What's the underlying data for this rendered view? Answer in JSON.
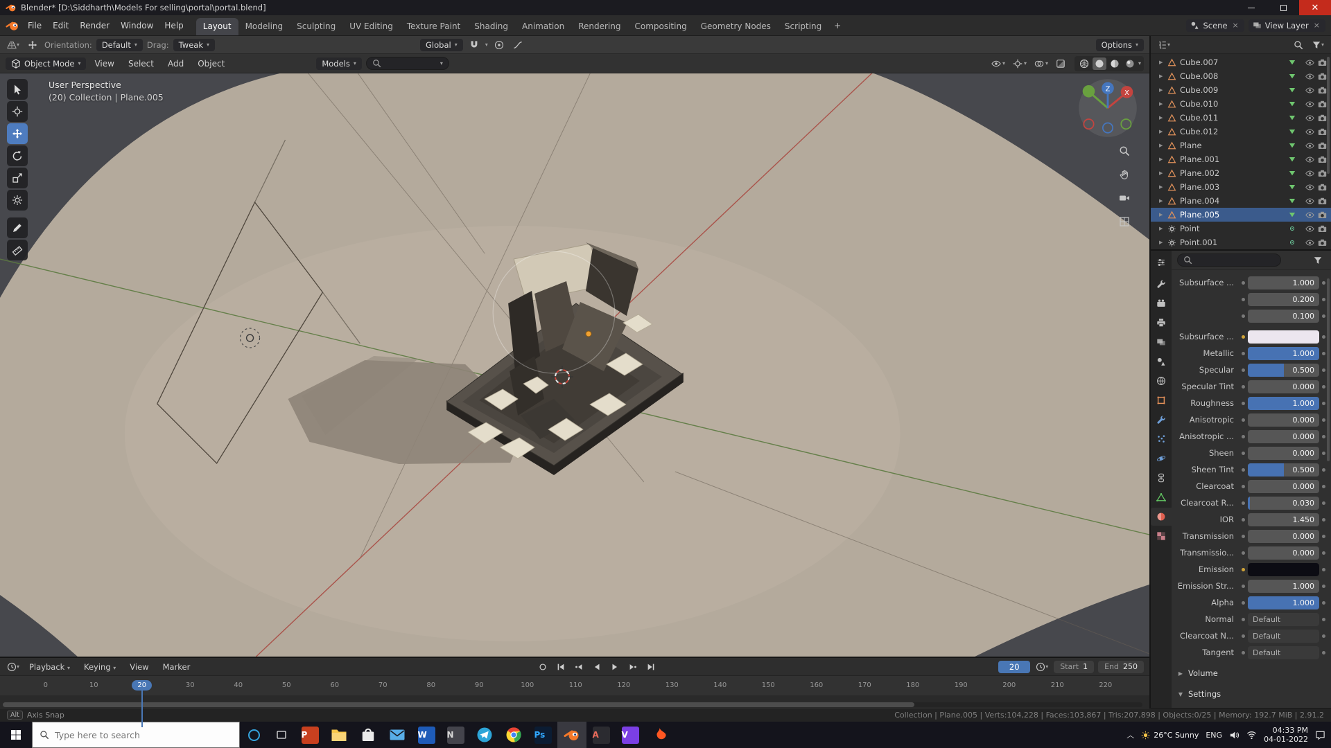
{
  "window": {
    "title": "Blender* [D:\\Siddharth\\Models For selling\\portal\\portal.blend]"
  },
  "topbar": {
    "menus": [
      "File",
      "Edit",
      "Render",
      "Window",
      "Help"
    ],
    "workspaces": [
      {
        "label": "Layout",
        "cls": "active"
      },
      {
        "label": "Modeling"
      },
      {
        "label": "Sculpting"
      },
      {
        "label": "UV Editing"
      },
      {
        "label": "Texture Paint"
      },
      {
        "label": "Shading"
      },
      {
        "label": "Animation"
      },
      {
        "label": "Rendering"
      },
      {
        "label": "Compositing"
      },
      {
        "label": "Geometry Nodes"
      },
      {
        "label": "Scripting"
      }
    ],
    "add_workspace": "+",
    "scene_label": "Scene",
    "view_layer_label": "View Layer"
  },
  "tool_settings": {
    "orientation_label": "Orientation:",
    "orientation_value": "Default",
    "drag_label": "Drag:",
    "drag_value": "Tweak",
    "transform_orientation": "Global",
    "options_label": "Options"
  },
  "viewport_header": {
    "mode": "Object Mode",
    "menus": [
      "View",
      "Select",
      "Add",
      "Object"
    ],
    "collection_filter": "Models"
  },
  "viewport": {
    "overlay_line1": "User Perspective",
    "overlay_line2": "(20) Collection | Plane.005",
    "gizmo_x": "X",
    "gizmo_z": "Z",
    "tools": [
      {
        "name": "select-box-tool",
        "icon": "#ic-select"
      },
      {
        "name": "cursor-tool",
        "icon": "#ic-cursor3d"
      },
      {
        "name": "move-tool",
        "icon": "#ic-move",
        "cls": "active"
      },
      {
        "name": "rotate-tool",
        "icon": "#ic-rotate"
      },
      {
        "name": "scale-tool",
        "icon": "#ic-scale"
      },
      {
        "name": "transform-tool",
        "icon": "#ic-transform"
      },
      {
        "name": "annotate-tool",
        "icon": "#ic-annotate",
        "cls": "gap"
      },
      {
        "name": "measure-tool",
        "icon": "#ic-measure"
      }
    ]
  },
  "outliner": {
    "items": [
      {
        "name": "Cube.007"
      },
      {
        "name": "Cube.008"
      },
      {
        "name": "Cube.009"
      },
      {
        "name": "Cube.010"
      },
      {
        "name": "Cube.011"
      },
      {
        "name": "Cube.012"
      },
      {
        "name": "Plane"
      },
      {
        "name": "Plane.001"
      },
      {
        "name": "Plane.002"
      },
      {
        "name": "Plane.003"
      },
      {
        "name": "Plane.004"
      },
      {
        "name": "Plane.005",
        "cls": "selected"
      },
      {
        "name": "Point",
        "cls": "light"
      },
      {
        "name": "Point.001",
        "cls": "light"
      }
    ]
  },
  "properties": {
    "tabs": [
      {
        "name": "tool-tab",
        "icon": "#ic-wrench",
        "color": "#c0c0c0"
      },
      {
        "name": "render-tab",
        "icon": "#ic-render",
        "color": "#c0c0c0"
      },
      {
        "name": "output-tab",
        "icon": "#ic-printer",
        "color": "#c0c0c0"
      },
      {
        "name": "view-layer-tab",
        "icon": "#ic-layers",
        "color": "#c0c0c0"
      },
      {
        "name": "scene-tab",
        "icon": "#ic-scene",
        "color": "#c0c0c0"
      },
      {
        "name": "world-tab",
        "icon": "#ic-world",
        "color": "#c0c0c0"
      },
      {
        "name": "object-tab",
        "icon": "#ic-object",
        "color": "#e8935a"
      },
      {
        "name": "modifiers-tab",
        "icon": "#ic-wrench",
        "color": "#6f9fd8"
      },
      {
        "name": "particles-tab",
        "icon": "#ic-particles",
        "color": "#6f9fd8"
      },
      {
        "name": "physics-tab",
        "icon": "#ic-physics",
        "color": "#6f9fd8"
      },
      {
        "name": "constraints-tab",
        "icon": "#ic-constraints",
        "color": "#c0c0c0"
      },
      {
        "name": "object-data-tab",
        "icon": "#ic-datatri",
        "color": "#63c763"
      },
      {
        "name": "material-tab",
        "icon": "#ic-material",
        "color": "#e06050",
        "cls": "active"
      },
      {
        "name": "texture-tab",
        "icon": "#ic-texture",
        "color": "#c87f8a"
      }
    ],
    "rows": [
      {
        "label": "Subsurface ...",
        "value": "1.000",
        "cls": "w-number"
      },
      {
        "label": "",
        "value": "0.200",
        "cls": "w-number"
      },
      {
        "label": "",
        "value": "0.100",
        "cls": "w-number"
      },
      {
        "label": "Subsurface ...",
        "value": "",
        "cls": "w-color gap-above decor-amber",
        "color": "#ece6ef"
      },
      {
        "label": "Metallic",
        "value": "1.000",
        "cls": "w-slider",
        "fill": "100%"
      },
      {
        "label": "Specular",
        "value": "0.500",
        "cls": "w-slider",
        "fill": "50%"
      },
      {
        "label": "Specular Tint",
        "value": "0.000",
        "cls": "w-slider",
        "fill": "0%"
      },
      {
        "label": "Roughness",
        "value": "1.000",
        "cls": "w-slider",
        "fill": "100%"
      },
      {
        "label": "Anisotropic",
        "value": "0.000",
        "cls": "w-slider",
        "fill": "0%"
      },
      {
        "label": "Anisotropic ...",
        "value": "0.000",
        "cls": "w-slider",
        "fill": "0%"
      },
      {
        "label": "Sheen",
        "value": "0.000",
        "cls": "w-slider",
        "fill": "0%"
      },
      {
        "label": "Sheen Tint",
        "value": "0.500",
        "cls": "w-slider",
        "fill": "50%"
      },
      {
        "label": "Clearcoat",
        "value": "0.000",
        "cls": "w-slider",
        "fill": "0%"
      },
      {
        "label": "Clearcoat R...",
        "value": "0.030",
        "cls": "w-slider",
        "fill": "3%"
      },
      {
        "label": "IOR",
        "value": "1.450",
        "cls": "w-number"
      },
      {
        "label": "Transmission",
        "value": "0.000",
        "cls": "w-slider",
        "fill": "0%"
      },
      {
        "label": "Transmissio...",
        "value": "0.000",
        "cls": "w-number"
      },
      {
        "label": "Emission",
        "value": "",
        "cls": "w-color decor-amber",
        "color": "#0c0c13"
      },
      {
        "label": "Emission Str...",
        "value": "1.000",
        "cls": "w-number"
      },
      {
        "label": "Alpha",
        "value": "1.000",
        "cls": "w-slider",
        "fill": "100%"
      },
      {
        "label": "Normal",
        "value": "Default",
        "cls": "w-default"
      },
      {
        "label": "Clearcoat N...",
        "value": "Default",
        "cls": "w-default"
      },
      {
        "label": "Tangent",
        "value": "Default",
        "cls": "w-default"
      }
    ],
    "volume_label": "Volume",
    "settings_label": "Settings"
  },
  "timeline": {
    "playback": "Playback",
    "keying": "Keying",
    "view": "View",
    "marker": "Marker",
    "current_frame": "20",
    "start_label": "Start",
    "start_value": "1",
    "end_label": "End",
    "end_value": "250",
    "ticks": [
      {
        "t": "0"
      },
      {
        "t": "10"
      },
      {
        "t": "20",
        "cls": "current"
      },
      {
        "t": "30"
      },
      {
        "t": "40"
      },
      {
        "t": "50"
      },
      {
        "t": "60"
      },
      {
        "t": "70"
      },
      {
        "t": "80"
      },
      {
        "t": "90"
      },
      {
        "t": "100"
      },
      {
        "t": "110"
      },
      {
        "t": "120"
      },
      {
        "t": "130"
      },
      {
        "t": "140"
      },
      {
        "t": "150"
      },
      {
        "t": "160"
      },
      {
        "t": "170"
      },
      {
        "t": "180"
      },
      {
        "t": "190"
      },
      {
        "t": "200"
      },
      {
        "t": "210"
      },
      {
        "t": "220"
      }
    ]
  },
  "status_bar": {
    "hint_key": "Alt",
    "hint_text": "Axis Snap",
    "stats": "Collection | Plane.005 | Verts:104,228 | Faces:103,867 | Tris:207,898 | Objects:0/25 | Memory: 192.7 MiB | 2.91.2"
  },
  "taskbar": {
    "search_placeholder": "Type here to search",
    "apps": [
      {
        "name": "powerpoint-icon",
        "label": "P",
        "bg": "#c8401f",
        "fg": "#ffffff"
      },
      {
        "name": "file-explorer-icon",
        "icon": "#ic-folder",
        "color": "#f7c64a"
      },
      {
        "name": "store-icon",
        "icon": "#ic-bag",
        "color": "#eaeaea"
      },
      {
        "name": "mail-icon",
        "icon": "#ic-mail",
        "color": "#58aee8"
      },
      {
        "name": "word-icon",
        "label": "W",
        "bg": "#1e5bb8",
        "fg": "#ffffff"
      },
      {
        "name": "notes-app-icon",
        "label": "N",
        "bg": "#44444c",
        "fg": "#d8d8d8"
      },
      {
        "name": "telegram-icon",
        "icon": "#ic-telegram",
        "color": "#2da5d8"
      },
      {
        "name": "chrome-icon",
        "icon": "#ic-chrome"
      },
      {
        "name": "photoshop-icon",
        "label": "Ps",
        "bg": "#0b1c33",
        "fg": "#31a8ff"
      },
      {
        "name": "blender-icon",
        "icon": "#ic-blenderlogo",
        "cls": "active"
      },
      {
        "name": "audio-app-icon",
        "label": "A",
        "bg": "#2b2b30",
        "fg": "#e86a5a"
      },
      {
        "name": "vlc-icon",
        "label": "V",
        "bg": "#7b3fe4",
        "fg": "#ffffff"
      },
      {
        "name": "flame-app-icon",
        "icon": "#ic-flame",
        "color": "#ff5722"
      }
    ],
    "weather": "26°C Sunny",
    "lang": "ENG",
    "time": "04:33 PM",
    "date": "04-01-2022"
  }
}
